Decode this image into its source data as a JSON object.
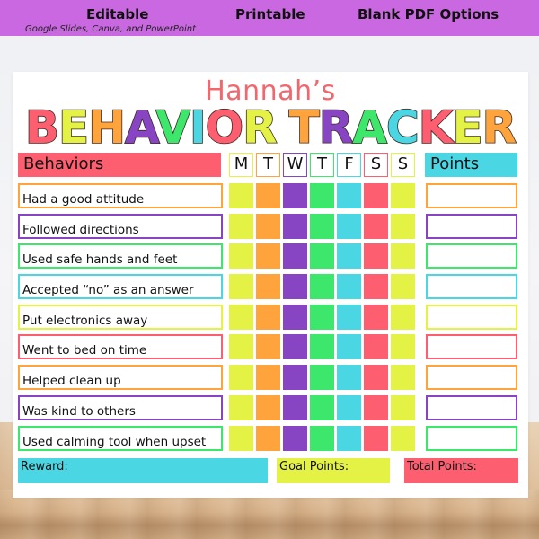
{
  "banner": {
    "features": [
      "Editable",
      "Printable",
      "Blank PDF Options"
    ],
    "subtitle": "Google Slides, Canva, and PowerPoint"
  },
  "colors": {
    "banner": "#c968e0",
    "red": "#fd5e70",
    "yellow": "#e4f145",
    "orange": "#ffa43c",
    "purple": "#8845c3",
    "green": "#3de76b",
    "cyan": "#4bd6e4",
    "name": "#f0676e"
  },
  "chart": {
    "child_name": "Hannah’s",
    "title_words": [
      {
        "letters": [
          {
            "ch": "B",
            "color": "#fd5e70"
          },
          {
            "ch": "E",
            "color": "#e4f145"
          },
          {
            "ch": "H",
            "color": "#ffa43c"
          },
          {
            "ch": "A",
            "color": "#8845c3"
          },
          {
            "ch": "V",
            "color": "#3de76b"
          },
          {
            "ch": "I",
            "color": "#4bd6e4"
          },
          {
            "ch": "O",
            "color": "#fd5e70"
          },
          {
            "ch": "R",
            "color": "#e4f145"
          }
        ]
      },
      {
        "letters": [
          {
            "ch": "T",
            "color": "#ffa43c"
          },
          {
            "ch": "R",
            "color": "#8845c3"
          },
          {
            "ch": "A",
            "color": "#3de76b"
          },
          {
            "ch": "C",
            "color": "#4bd6e4"
          },
          {
            "ch": "K",
            "color": "#fd5e70"
          },
          {
            "ch": "E",
            "color": "#e4f145"
          },
          {
            "ch": "R",
            "color": "#ffa43c"
          }
        ]
      }
    ],
    "behaviors_header": "Behaviors",
    "points_header": "Points",
    "days": [
      {
        "label": "M",
        "color": "#e4f145"
      },
      {
        "label": "T",
        "color": "#ffa43c"
      },
      {
        "label": "W",
        "color": "#8845c3"
      },
      {
        "label": "T",
        "color": "#3de76b"
      },
      {
        "label": "F",
        "color": "#4bd6e4"
      },
      {
        "label": "S",
        "color": "#fd5e70"
      },
      {
        "label": "S",
        "color": "#e4f145"
      }
    ],
    "behaviors": [
      {
        "label": "Had a good attitude",
        "color": "#ffa43c"
      },
      {
        "label": "Followed directions",
        "color": "#8845c3"
      },
      {
        "label": "Used safe hands and feet",
        "color": "#3de76b"
      },
      {
        "label": "Accepted “no” as an answer",
        "color": "#4bd6e4"
      },
      {
        "label": "Put electronics away",
        "color": "#e4f145"
      },
      {
        "label": "Went to bed on time",
        "color": "#fd5e70"
      },
      {
        "label": "Helped clean up",
        "color": "#ffa43c"
      },
      {
        "label": "Was kind to others",
        "color": "#8845c3"
      },
      {
        "label": "Used calming tool when upset",
        "color": "#3de76b"
      }
    ],
    "footer": {
      "reward": "Reward:",
      "goal_points": "Goal Points:",
      "total_points": "Total Points:"
    }
  }
}
